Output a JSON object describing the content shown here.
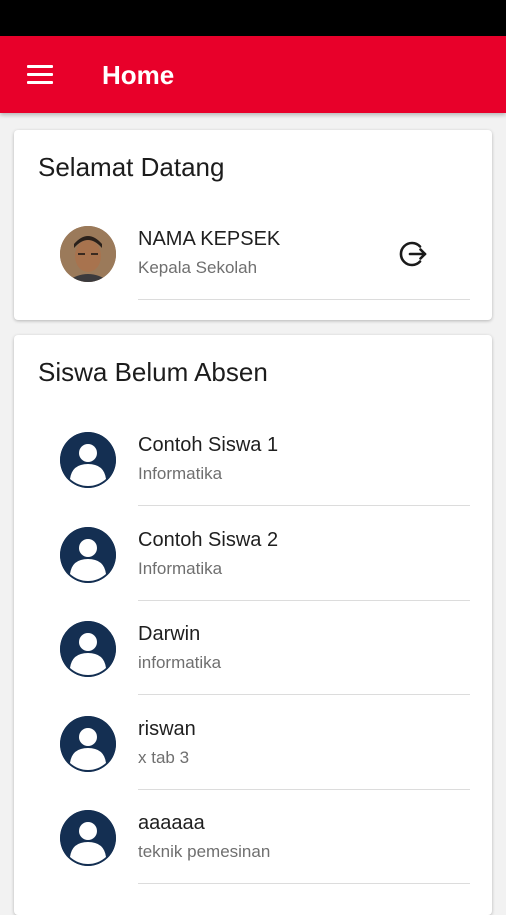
{
  "app_bar": {
    "title": "Home",
    "menu_icon": "menu-icon"
  },
  "welcome_card": {
    "title": "Selamat Datang",
    "user": {
      "name": "NAMA KEPSEK",
      "role": "Kepala Sekolah"
    },
    "logout_icon": "logout-icon"
  },
  "absent_card": {
    "title": "Siswa Belum Absen",
    "students": [
      {
        "name": "Contoh Siswa 1",
        "class": "Informatika"
      },
      {
        "name": "Contoh Siswa 2",
        "class": "Informatika"
      },
      {
        "name": "Darwin",
        "class": "informatika"
      },
      {
        "name": "riswan",
        "class": "x tab 3"
      },
      {
        "name": "aaaaaa",
        "class": "teknik pemesinan"
      }
    ]
  },
  "colors": {
    "app_bar": "#e8002a",
    "avatar": "#142f52",
    "status_bar": "#000000"
  }
}
